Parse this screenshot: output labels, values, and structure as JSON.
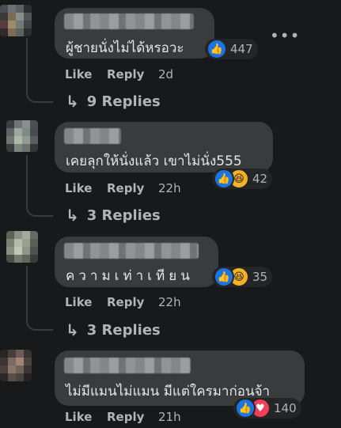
{
  "more_icon": "more-horizontal-icon",
  "comments": [
    {
      "text": "ผู้ชายนั่งไม่ได้หรอวะ",
      "reactions": [
        "like"
      ],
      "reaction_count": "447",
      "like_label": "Like",
      "reply_label": "Reply",
      "time": "2d",
      "replies_label": "9 Replies"
    },
    {
      "text": "เคยลุกให้นั่งแล้ว เขาไม่นั่ง555",
      "reactions": [
        "like",
        "haha"
      ],
      "reaction_count": "42",
      "like_label": "Like",
      "reply_label": "Reply",
      "time": "22h",
      "replies_label": "3 Replies"
    },
    {
      "text": "ความเท่าเทียน",
      "reactions": [
        "like",
        "haha"
      ],
      "reaction_count": "35",
      "like_label": "Like",
      "reply_label": "Reply",
      "time": "22h",
      "replies_label": "3 Replies"
    },
    {
      "text": "ไม่มีแมนไม่แมน มีแต่ใครมาก่อนจ้า",
      "reactions": [
        "like",
        "love"
      ],
      "reaction_count": "140",
      "like_label": "Like",
      "reply_label": "Reply",
      "time": "21h"
    }
  ],
  "colors": {
    "background": "#18191a",
    "bubble": "#3a3b3c",
    "like_blue": "#1b74e4",
    "haha_yellow": "#f7b125",
    "love_red": "#f33e58"
  }
}
